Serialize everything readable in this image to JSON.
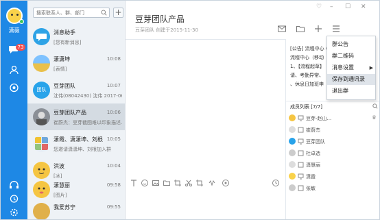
{
  "user": {
    "name": "潇薇",
    "badge": "73"
  },
  "search": {
    "placeholder": "搜索联系人、群、部门"
  },
  "add_label": "+",
  "conversations": [
    {
      "name": "消息助手",
      "preview": "[您有新消息]",
      "time": ""
    },
    {
      "name": "潇潇坤",
      "preview": "[表情]",
      "time": "10:08"
    },
    {
      "name": "豆芽团队",
      "preview": "沈伟(08042430) 沈伟 2017-06...",
      "time": "10:07"
    },
    {
      "name": "豆芽团队产品",
      "preview": "崔蔚杰：豆芽截图难以印象描述...",
      "time": "10:06"
    },
    {
      "name": "潇霞、潇潇坤、刘根",
      "preview": "您邀请潇潇坤、刘根加入群",
      "time": "10:05"
    },
    {
      "name": "洪波",
      "preview": "[冰]",
      "time": "10:04"
    },
    {
      "name": "潇慧丽",
      "preview": "[图片]",
      "time": "09:58"
    },
    {
      "name": "我爱苏宁",
      "preview": "",
      "time": "09:55"
    }
  ],
  "chat": {
    "title": "豆芽团队产品",
    "subtitle": "豆芽团队 创建于2015-11-30"
  },
  "window_controls": {
    "pin": "♡",
    "min": "–",
    "max": "☐",
    "close": "✕"
  },
  "notice": {
    "lines": [
      "[公告] 流程中心 ( ",
      "流程中心（移动",
      "1、【流程起草】",
      "请、考勤异常、",
      "、休息日加班申"
    ]
  },
  "members": {
    "header": "成员列表 [7/7]",
    "list": [
      "豆芽-赵山...",
      "崔蔚杰",
      "豆芽团队",
      "杜卓选",
      "潇慧丽",
      "潇霞",
      "张敏"
    ]
  },
  "menu": {
    "items": [
      "群公告",
      "群二维码",
      "消息设置",
      "保存到通讯录",
      "退出群"
    ]
  },
  "colors": {
    "rail": "#1e88e5",
    "accent": "#1e88e5",
    "selected": "#d4dbe2"
  }
}
